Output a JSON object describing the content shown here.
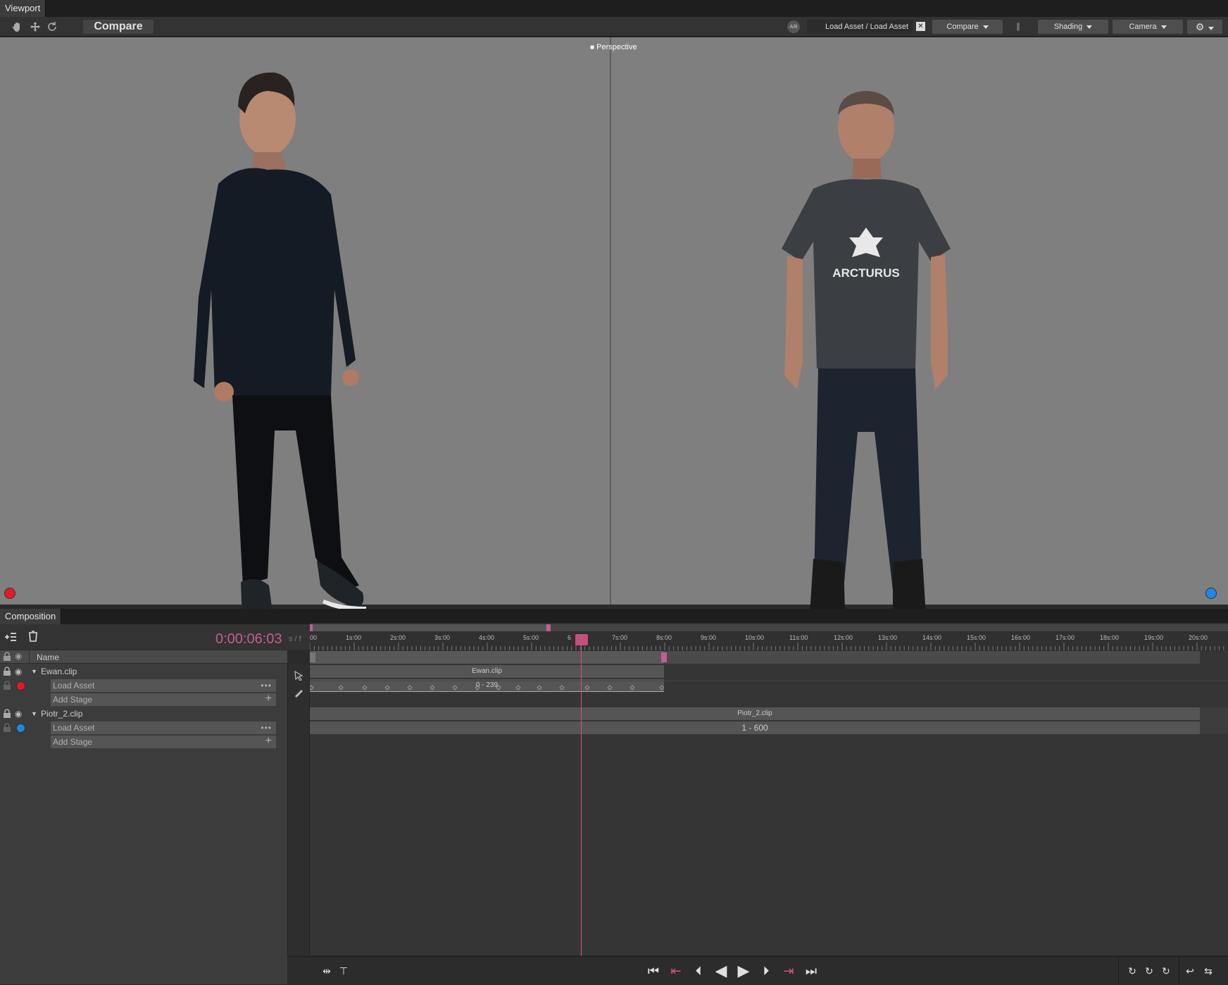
{
  "viewport_tab": "Viewport",
  "toolbar": {
    "mode": "Compare",
    "load_asset": "Load Asset / Load Asset",
    "compare_btn": "Compare",
    "shading_btn": "Shading",
    "camera_btn": "Camera"
  },
  "viewport": {
    "camera_label": "Perspective",
    "shirt_text": "ARCTURUS",
    "left_marker_color": "#e21b23",
    "right_marker_color": "#1e88e5"
  },
  "composition": {
    "tab": "Composition",
    "timecode": "0:00:06:03",
    "unit_toggle": "s / f",
    "name_header": "Name",
    "ruler_labels": [
      "00",
      "1s:00",
      "2s:00",
      "3s:00",
      "4s:00",
      "5s:00",
      "6",
      "7s:00",
      "8s:00",
      "9s:00",
      "10s:00",
      "11s:00",
      "12s:00",
      "13s:00",
      "14s:00",
      "15s:00",
      "16s:00",
      "17s:00",
      "18s:00",
      "19s:00",
      "20s:00"
    ],
    "tracks": [
      {
        "name": "Ewan.clip",
        "marker_color": "#e21b23",
        "stage": "Load Asset",
        "add": "Add Stage",
        "clip_label": "Ewan.clip",
        "range": "0 - 239"
      },
      {
        "name": "Piotr_2.clip",
        "marker_color": "#1e88e5",
        "stage": "Load Asset",
        "add": "Add Stage",
        "clip_label": "Piotr_2.clip",
        "range": "1 - 600"
      }
    ]
  },
  "accent_color": "#d94f8a"
}
